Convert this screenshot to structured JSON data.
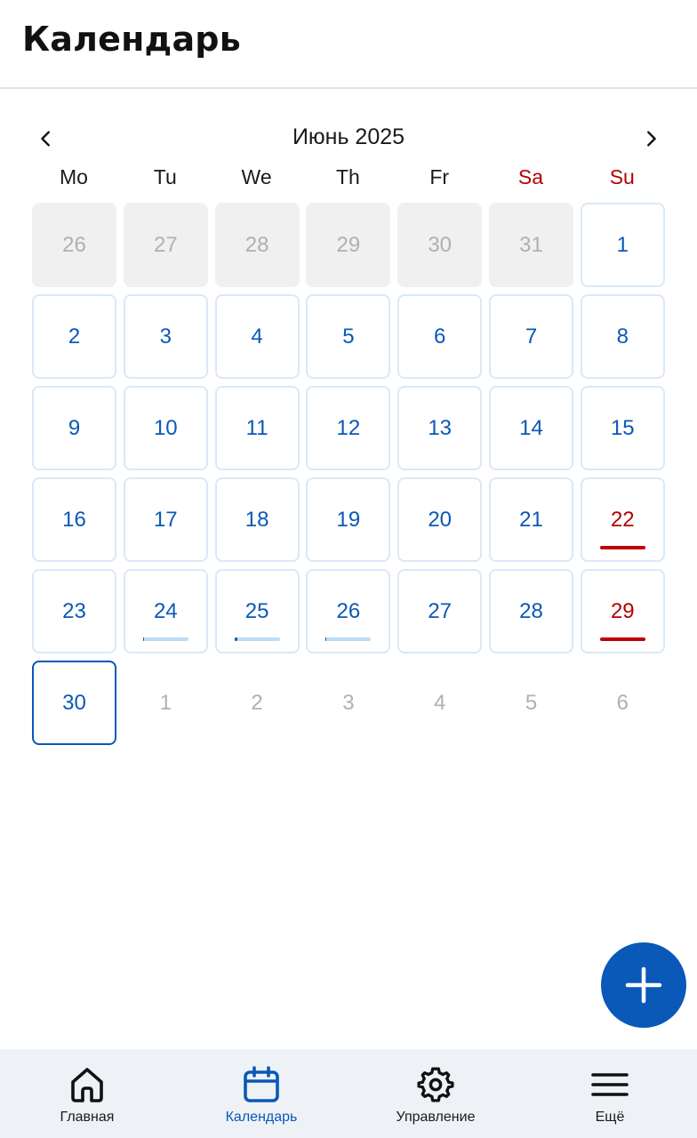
{
  "header": {
    "title": "Календарь"
  },
  "calendar": {
    "month_title": "Июнь 2025",
    "weekdays": [
      {
        "label": "Mo",
        "weekend": false
      },
      {
        "label": "Tu",
        "weekend": false
      },
      {
        "label": "We",
        "weekend": false
      },
      {
        "label": "Th",
        "weekend": false
      },
      {
        "label": "Fr",
        "weekend": false
      },
      {
        "label": "Sa",
        "weekend": true
      },
      {
        "label": "Su",
        "weekend": true
      }
    ],
    "days": [
      {
        "label": "26",
        "state": "outside-prev"
      },
      {
        "label": "27",
        "state": "outside-prev"
      },
      {
        "label": "28",
        "state": "outside-prev"
      },
      {
        "label": "29",
        "state": "outside-prev"
      },
      {
        "label": "30",
        "state": "outside-prev"
      },
      {
        "label": "31",
        "state": "outside-prev"
      },
      {
        "label": "1",
        "state": "current"
      },
      {
        "label": "2",
        "state": "current"
      },
      {
        "label": "3",
        "state": "current"
      },
      {
        "label": "4",
        "state": "current"
      },
      {
        "label": "5",
        "state": "current"
      },
      {
        "label": "6",
        "state": "current"
      },
      {
        "label": "7",
        "state": "current"
      },
      {
        "label": "8",
        "state": "current"
      },
      {
        "label": "9",
        "state": "current"
      },
      {
        "label": "10",
        "state": "current"
      },
      {
        "label": "11",
        "state": "current"
      },
      {
        "label": "12",
        "state": "current"
      },
      {
        "label": "13",
        "state": "current"
      },
      {
        "label": "14",
        "state": "current"
      },
      {
        "label": "15",
        "state": "current"
      },
      {
        "label": "16",
        "state": "current"
      },
      {
        "label": "17",
        "state": "current"
      },
      {
        "label": "18",
        "state": "current"
      },
      {
        "label": "19",
        "state": "current"
      },
      {
        "label": "20",
        "state": "current"
      },
      {
        "label": "21",
        "state": "current"
      },
      {
        "label": "22",
        "state": "holiday",
        "indicator": "red"
      },
      {
        "label": "23",
        "state": "current"
      },
      {
        "label": "24",
        "state": "current",
        "indicator": "progress",
        "progress": 0.02
      },
      {
        "label": "25",
        "state": "current",
        "indicator": "progress",
        "progress": 0.06
      },
      {
        "label": "26",
        "state": "current",
        "indicator": "progress",
        "progress": 0.02
      },
      {
        "label": "27",
        "state": "current"
      },
      {
        "label": "28",
        "state": "current"
      },
      {
        "label": "29",
        "state": "holiday",
        "indicator": "red"
      },
      {
        "label": "30",
        "state": "today"
      },
      {
        "label": "1",
        "state": "outside-next"
      },
      {
        "label": "2",
        "state": "outside-next"
      },
      {
        "label": "3",
        "state": "outside-next"
      },
      {
        "label": "4",
        "state": "outside-next"
      },
      {
        "label": "5",
        "state": "outside-next"
      },
      {
        "label": "6",
        "state": "outside-next"
      }
    ]
  },
  "fab": {
    "icon": "plus-icon"
  },
  "bottom_nav": {
    "items": [
      {
        "label": "Главная",
        "icon": "home-icon",
        "active": false
      },
      {
        "label": "Календарь",
        "icon": "calendar-icon",
        "active": true
      },
      {
        "label": "Управление",
        "icon": "gear-icon",
        "active": false
      },
      {
        "label": "Ещё",
        "icon": "menu-icon",
        "active": false
      }
    ]
  },
  "colors": {
    "accent": "#0a58b8",
    "holiday": "#b40000",
    "muted": "#b0b0b0",
    "nav_background": "#eef2f6"
  }
}
